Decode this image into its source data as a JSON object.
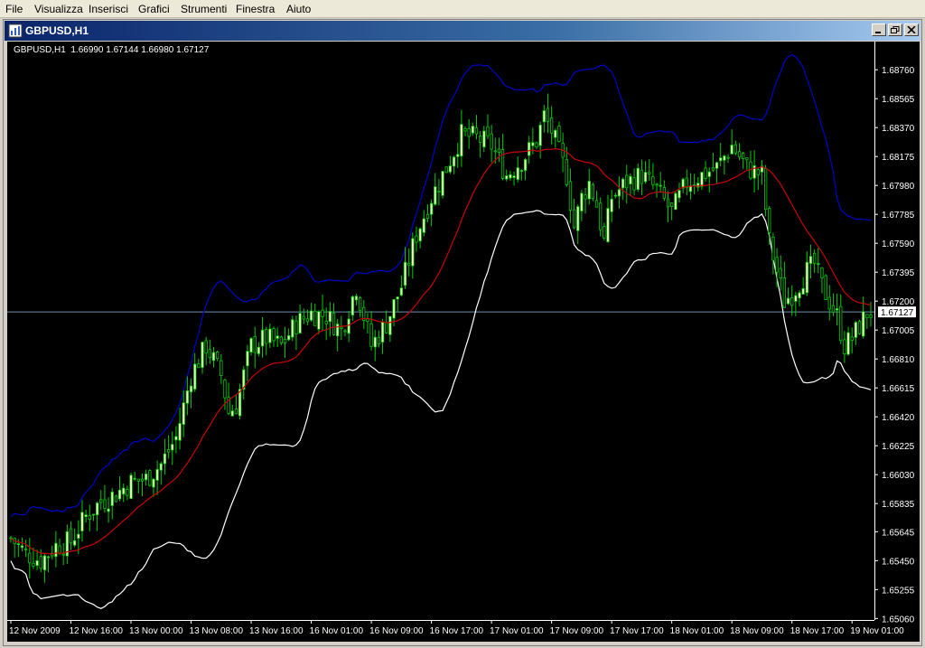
{
  "menu": [
    {
      "label": "File"
    },
    {
      "label": "Visualizza"
    },
    {
      "label": "Inserisci"
    },
    {
      "label": "Grafici"
    },
    {
      "label": "Strumenti"
    },
    {
      "label": "Finestra"
    },
    {
      "label": "Aiuto"
    }
  ],
  "window": {
    "title": "GBPUSD,H1",
    "minimize_icon": "minimize-icon",
    "restore_icon": "restore-icon",
    "close_icon": "close-icon"
  },
  "chart_data": {
    "type": "candlestick",
    "symbol_line": "GBPUSD,H1  1.66990 1.67144 1.66980 1.67127",
    "background": "#000000",
    "grid": false,
    "colors": {
      "bull": "#ffffcc",
      "bear": "#000000",
      "wick": "#00cc00",
      "ma": "#cc0000",
      "upper_band": "#0000cc",
      "lower_band": "#ffffff",
      "price_line": "#6f8fb0"
    },
    "current_price": 1.67127,
    "current_price_label": "1.67127",
    "ylim": [
      1.6505,
      1.6895
    ],
    "y_ticks": [
      "1.68760",
      "1.68565",
      "1.68370",
      "1.68175",
      "1.67980",
      "1.67785",
      "1.67590",
      "1.67395",
      "1.67200",
      "1.67005",
      "1.66810",
      "1.66615",
      "1.66420",
      "1.66225",
      "1.66030",
      "1.65835",
      "1.65645",
      "1.65450",
      "1.65255",
      "1.65060"
    ],
    "x_labels": [
      {
        "index": 0,
        "label": "12 Nov 2009"
      },
      {
        "index": 16,
        "label": "12 Nov 16:00"
      },
      {
        "index": 32,
        "label": "13 Nov 00:00"
      },
      {
        "index": 48,
        "label": "13 Nov 08:00"
      },
      {
        "index": 64,
        "label": "13 Nov 16:00"
      },
      {
        "index": 80,
        "label": "16 Nov 01:00"
      },
      {
        "index": 96,
        "label": "16 Nov 09:00"
      },
      {
        "index": 112,
        "label": "16 Nov 17:00"
      },
      {
        "index": 128,
        "label": "17 Nov 01:00"
      },
      {
        "index": 144,
        "label": "17 Nov 09:00"
      },
      {
        "index": 160,
        "label": "17 Nov 17:00"
      },
      {
        "index": 176,
        "label": "18 Nov 01:00"
      },
      {
        "index": 192,
        "label": "18 Nov 09:00"
      },
      {
        "index": 208,
        "label": "18 Nov 17:00"
      },
      {
        "index": 224,
        "label": "19 Nov 01:00"
      }
    ],
    "close_anchors": [
      [
        0,
        1.656
      ],
      [
        4,
        1.655
      ],
      [
        8,
        1.6545
      ],
      [
        12,
        1.6555
      ],
      [
        16,
        1.6558
      ],
      [
        20,
        1.6575
      ],
      [
        24,
        1.6585
      ],
      [
        28,
        1.659
      ],
      [
        32,
        1.6598
      ],
      [
        36,
        1.66
      ],
      [
        40,
        1.661
      ],
      [
        44,
        1.6628
      ],
      [
        48,
        1.667
      ],
      [
        52,
        1.669
      ],
      [
        56,
        1.667
      ],
      [
        58,
        1.6645
      ],
      [
        60,
        1.665
      ],
      [
        64,
        1.669
      ],
      [
        68,
        1.6695
      ],
      [
        72,
        1.669
      ],
      [
        76,
        1.6705
      ],
      [
        80,
        1.6712
      ],
      [
        84,
        1.671
      ],
      [
        88,
        1.67
      ],
      [
        92,
        1.673
      ],
      [
        96,
        1.669
      ],
      [
        100,
        1.6705
      ],
      [
        104,
        1.673
      ],
      [
        108,
        1.6765
      ],
      [
        112,
        1.679
      ],
      [
        116,
        1.681
      ],
      [
        120,
        1.6832
      ],
      [
        124,
        1.683
      ],
      [
        128,
        1.6825
      ],
      [
        132,
        1.6805
      ],
      [
        136,
        1.6815
      ],
      [
        140,
        1.6828
      ],
      [
        142,
        1.6845
      ],
      [
        144,
        1.6835
      ],
      [
        148,
        1.6805
      ],
      [
        150,
        1.677
      ],
      [
        152,
        1.679
      ],
      [
        154,
        1.68
      ],
      [
        156,
        1.6785
      ],
      [
        158,
        1.676
      ],
      [
        160,
        1.679
      ],
      [
        164,
        1.68
      ],
      [
        168,
        1.6805
      ],
      [
        172,
        1.6795
      ],
      [
        176,
        1.678
      ],
      [
        180,
        1.68
      ],
      [
        184,
        1.6805
      ],
      [
        188,
        1.681
      ],
      [
        192,
        1.6825
      ],
      [
        196,
        1.681
      ],
      [
        200,
        1.6805
      ],
      [
        202,
        1.676
      ],
      [
        204,
        1.674
      ],
      [
        206,
        1.672
      ],
      [
        208,
        1.6725
      ],
      [
        212,
        1.674
      ],
      [
        214,
        1.6745
      ],
      [
        216,
        1.673
      ],
      [
        220,
        1.671
      ],
      [
        222,
        1.669
      ],
      [
        224,
        1.6695
      ],
      [
        228,
        1.6712
      ]
    ]
  }
}
